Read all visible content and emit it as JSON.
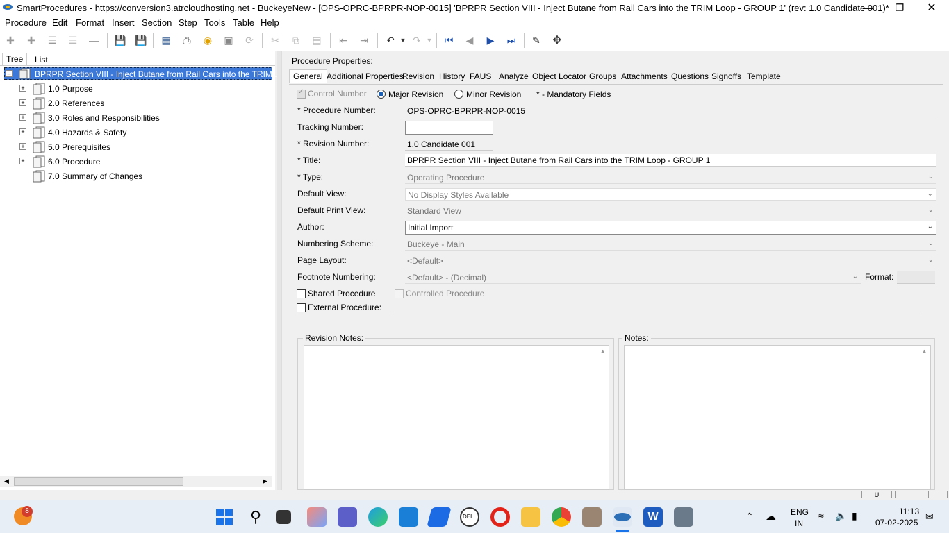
{
  "window": {
    "title": "SmartProcedures - https://conversion3.atrcloudhosting.net - BuckeyeNew - [OPS-OPRC-BPRPR-NOP-0015] 'BPRPR Section VIII - Inject Butane from Rail Cars into the TRIM Loop - GROUP 1' (rev: 1.0 Candidate 001)*"
  },
  "menu": [
    "Procedure",
    "Edit",
    "Format",
    "Insert",
    "Section",
    "Step",
    "Tools",
    "Table",
    "Help"
  ],
  "left_tabs": [
    "Tree",
    "List"
  ],
  "tree": {
    "root": "BPRPR Section VIII - Inject Butane from Rail Cars into the TRIM...",
    "items": [
      "1.0 Purpose",
      "2.0 References",
      "3.0 Roles and Responsibilities",
      "4.0 Hazards & Safety",
      "5.0 Prerequisites",
      "6.0 Procedure",
      "7.0 Summary of Changes"
    ]
  },
  "properties_header": "Procedure Properties:",
  "tabs": [
    "General",
    "Additional Properties",
    "Revision",
    "History",
    "FAUS",
    "Analyze",
    "Object Locator",
    "Groups",
    "Attachments",
    "Questions",
    "Signoffs",
    "Template"
  ],
  "options": {
    "control_number": "Control Number",
    "major_revision": "Major Revision",
    "minor_revision": "Minor Revision",
    "mandatory": "* - Mandatory Fields"
  },
  "fields": {
    "procedure_number_label": "* Procedure Number:",
    "procedure_number": "OPS-OPRC-BPRPR-NOP-0015",
    "tracking_number_label": "Tracking Number:",
    "tracking_number": "",
    "revision_number_label": "* Revision Number:",
    "revision_number": "1.0 Candidate 001",
    "title_label": "* Title:",
    "title": "BPRPR Section VIII - Inject Butane from Rail Cars into the TRIM Loop - GROUP 1",
    "type_label": "* Type:",
    "type": "Operating Procedure",
    "default_view_label": "Default View:",
    "default_view": "No Display Styles Available",
    "default_print_view_label": "Default Print View:",
    "default_print_view": "Standard View",
    "author_label": "Author:",
    "author": "Initial Import",
    "numbering_scheme_label": "Numbering Scheme:",
    "numbering_scheme": "Buckeye - Main",
    "page_layout_label": "Page Layout:",
    "page_layout": "<Default>",
    "footnote_numbering_label": "Footnote Numbering:",
    "footnote_numbering": "<Default> - (Decimal)",
    "format_label": "Format:",
    "shared_procedure": "Shared Procedure",
    "controlled_procedure": "Controlled Procedure",
    "external_procedure": "External Procedure:"
  },
  "revision_notes_label": "Revision Notes:",
  "notes_label": "Notes:",
  "status": {
    "u": "U"
  },
  "taskbar": {
    "badge": "8",
    "lang1": "ENG",
    "lang2": "IN",
    "time": "11:13",
    "date": "07-02-2025"
  }
}
